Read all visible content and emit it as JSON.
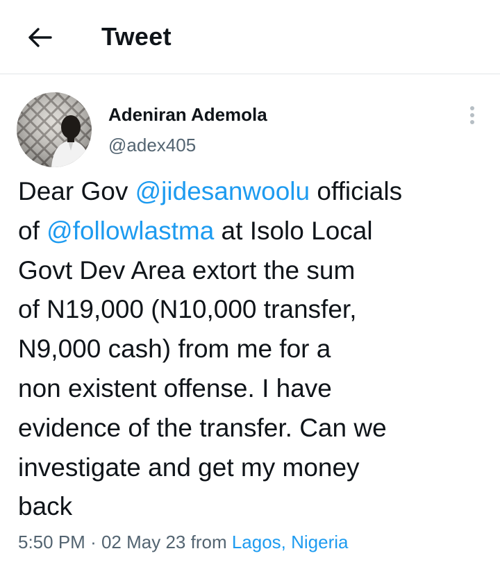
{
  "header": {
    "back_icon": "arrow-left-icon",
    "title": "Tweet"
  },
  "tweet": {
    "author": {
      "name": "Adeniran Ademola",
      "handle": "@adex405",
      "avatar": "user-photo-avatar"
    },
    "more_icon": "vertical-ellipsis-icon",
    "text_lines": [
      {
        "before": "Dear Gov ",
        "mention": "@jidesanwoolu",
        "after": " officials"
      },
      {
        "before": "of ",
        "mention": "@followlastma",
        "after": " at Isolo Local"
      },
      {
        "before": "Govt Dev Area extort the sum",
        "mention": "",
        "after": ""
      },
      {
        "before": "of N19,000 (N10,000 transfer,",
        "mention": "",
        "after": ""
      },
      {
        "before": "N9,000 cash) from me for a",
        "mention": "",
        "after": ""
      },
      {
        "before": "non existent offense. I have",
        "mention": "",
        "after": ""
      },
      {
        "before": "evidence of the transfer. Can we",
        "mention": "",
        "after": ""
      },
      {
        "before": "investigate and get my money",
        "mention": "",
        "after": ""
      },
      {
        "before": "back",
        "mention": "",
        "after": ""
      }
    ],
    "time": "5:50 PM",
    "separator": "·",
    "date": "02 May 23",
    "from_label": "from",
    "location": "Lagos, Nigeria"
  },
  "colors": {
    "text": "#0f1419",
    "secondary": "#536471",
    "link": "#1d9bf0",
    "divider": "#e1e5e8"
  }
}
